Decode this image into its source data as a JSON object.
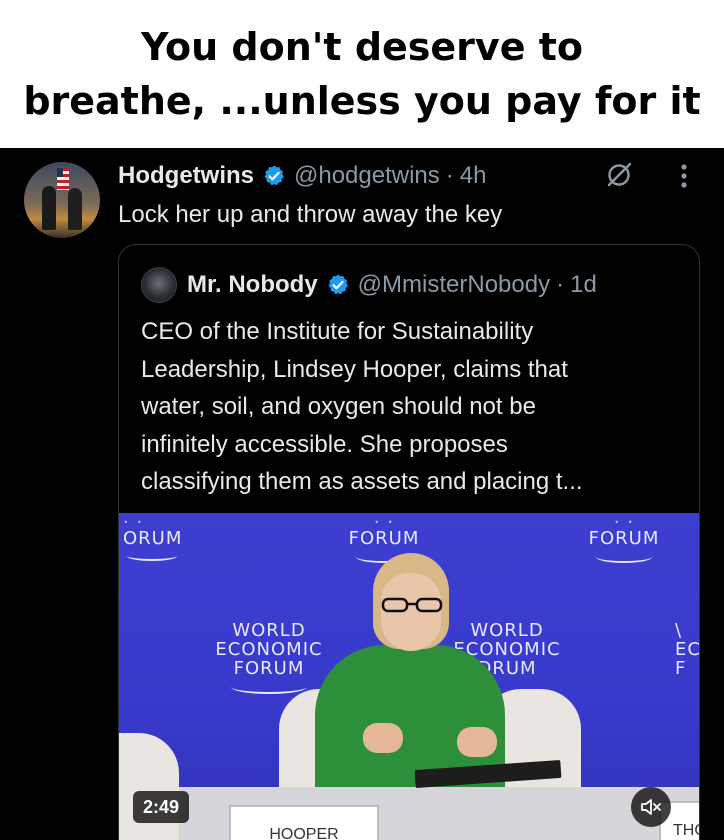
{
  "caption": {
    "line1": "You don't deserve to",
    "line2": "breathe, ...unless you pay for it"
  },
  "tweet": {
    "author_name": "Hodgetwins",
    "handle": "@hodgetwins",
    "separator": "·",
    "time": "4h",
    "text": "Lock her up and throw away the key",
    "icons": [
      "verified-badge-icon",
      "grok-icon",
      "more-icon"
    ]
  },
  "quote": {
    "author_name": "Mr. Nobody",
    "handle": "@MmisterNobody",
    "separator": "·",
    "time": "1d",
    "lines": [
      "CEO of the Institute for Sustainability",
      "Leadership, Lindsey Hooper, claims that",
      "water, soil, and oxygen should not be",
      "infinitely accessible. She proposes",
      "classifying them as assets and placing t..."
    ]
  },
  "video": {
    "duration": "2:49",
    "backdrop": {
      "top_left": "ORUM",
      "top_mid_word": "FORUM",
      "top_right_word": "FORUM",
      "logo_line1": "WORLD",
      "logo_line2": "ECONOMIC",
      "logo_line3": "FORUM",
      "logo2_line1": "WORLD",
      "logo2_line2": "ECONOMIC",
      "logo2_line3": "DRUM",
      "edge_line2": "EC",
      "edge_line3": "F"
    },
    "nameplate": "HOOPER",
    "nameplate_right": "THO",
    "icons": [
      "mute-icon"
    ]
  },
  "colors": {
    "background": "#000000",
    "caption_bg": "#ffffff",
    "text_primary": "#e7e9ea",
    "text_secondary": "#8b98a5",
    "verified": "#1d9bf0",
    "wef_blue": "#3a3cd0"
  }
}
